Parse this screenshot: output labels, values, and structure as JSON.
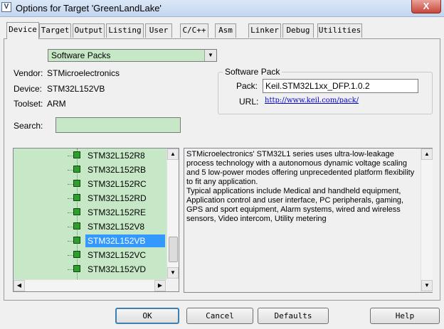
{
  "window": {
    "title": "Options for Target 'GreenLandLake'",
    "app_icon_glyph": "V",
    "close_glyph": "X"
  },
  "tabs": [
    {
      "label": "Device",
      "active": true
    },
    {
      "label": "Target"
    },
    {
      "label": "Output"
    },
    {
      "label": "Listing"
    },
    {
      "label": "User"
    },
    {
      "label": "C/C++"
    },
    {
      "label": "Asm"
    },
    {
      "label": "Linker"
    },
    {
      "label": "Debug"
    },
    {
      "label": "Utilities"
    }
  ],
  "device": {
    "pack_select": "Software Packs",
    "vendor_label": "Vendor:",
    "vendor_value": "STMicroelectronics",
    "device_label": "Device:",
    "device_value": "STM32L152VB",
    "toolset_label": "Toolset:",
    "toolset_value": "ARM",
    "search_label": "Search:",
    "search_value": ""
  },
  "software_pack": {
    "legend": "Software Pack",
    "pack_label": "Pack:",
    "pack_value": "Keil.STM32L1xx_DFP.1.0.2",
    "url_label": "URL:",
    "url_value": "http://www.keil.com/pack/"
  },
  "device_list": {
    "items": [
      {
        "name": "STM32L152R8"
      },
      {
        "name": "STM32L152RB"
      },
      {
        "name": "STM32L152RC"
      },
      {
        "name": "STM32L152RD"
      },
      {
        "name": "STM32L152RE"
      },
      {
        "name": "STM32L152V8"
      },
      {
        "name": "STM32L152VB",
        "selected": true
      },
      {
        "name": "STM32L152VC"
      },
      {
        "name": "STM32L152VD"
      }
    ]
  },
  "description": "STMicroelectronics' STM32L1 series uses ultra-low-leakage process technology with a autonomous dynamic voltage scaling and 5 low-power modes offering unprecedented platform flexibility to fit any application.\nTypical applications include Medical and handheld equipment, Application control and user interface, PC peripherals, gaming, GPS and sport equipment, Alarm systems, wired and wireless sensors, Video intercom, Utility metering",
  "buttons": {
    "ok": "OK",
    "cancel": "Cancel",
    "defaults": "Defaults",
    "help": "Help"
  },
  "colors": {
    "field_green": "#c7e8c7",
    "selection_blue": "#3399ff",
    "link_blue": "#0000cc"
  }
}
